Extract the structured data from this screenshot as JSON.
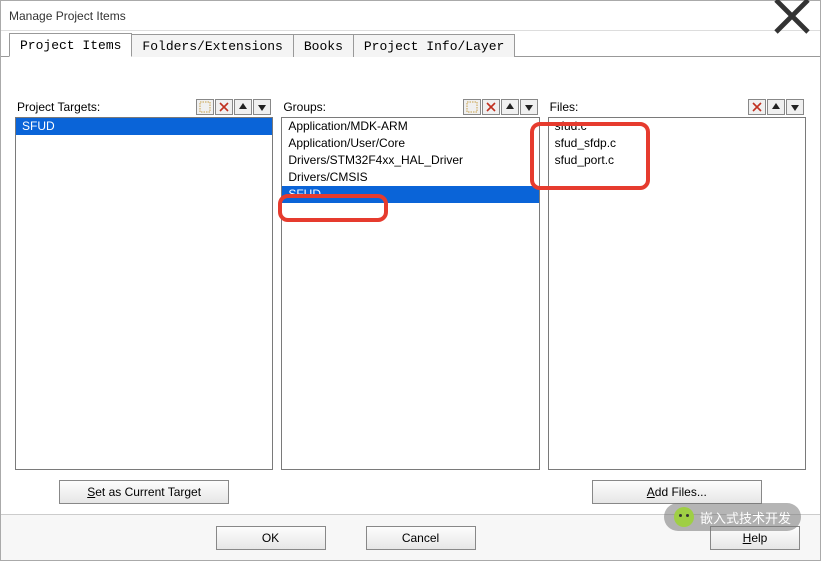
{
  "window": {
    "title": "Manage Project Items"
  },
  "tabs": [
    {
      "label": "Project Items",
      "active": true
    },
    {
      "label": "Folders/Extensions",
      "active": false
    },
    {
      "label": "Books",
      "active": false
    },
    {
      "label": "Project Info/Layer",
      "active": false
    }
  ],
  "columns": {
    "targets": {
      "label": "Project Targets:",
      "tools": {
        "new": "new-icon",
        "delete": "x-icon",
        "up": "up-icon",
        "down": "down-icon"
      },
      "items": [
        {
          "label": "SFUD",
          "selected": true
        }
      ],
      "footerButton": "Set as Current Target"
    },
    "groups": {
      "label": "Groups:",
      "tools": {
        "new": "new-icon",
        "delete": "x-icon",
        "up": "up-icon",
        "down": "down-icon"
      },
      "items": [
        {
          "label": "Application/MDK-ARM",
          "selected": false
        },
        {
          "label": "Application/User/Core",
          "selected": false
        },
        {
          "label": "Drivers/STM32F4xx_HAL_Driver",
          "selected": false
        },
        {
          "label": "Drivers/CMSIS",
          "selected": false
        },
        {
          "label": "SFUD",
          "selected": true
        }
      ]
    },
    "files": {
      "label": "Files:",
      "tools": {
        "delete": "x-icon",
        "up": "up-icon",
        "down": "down-icon"
      },
      "items": [
        {
          "label": "sfud.c",
          "selected": false
        },
        {
          "label": "sfud_sfdp.c",
          "selected": false
        },
        {
          "label": "sfud_port.c",
          "selected": false
        }
      ],
      "footerButton": "Add Files..."
    }
  },
  "buttons": {
    "ok": "OK",
    "cancel": "Cancel",
    "help": "Help"
  },
  "watermark": "嵌入式技术开发"
}
